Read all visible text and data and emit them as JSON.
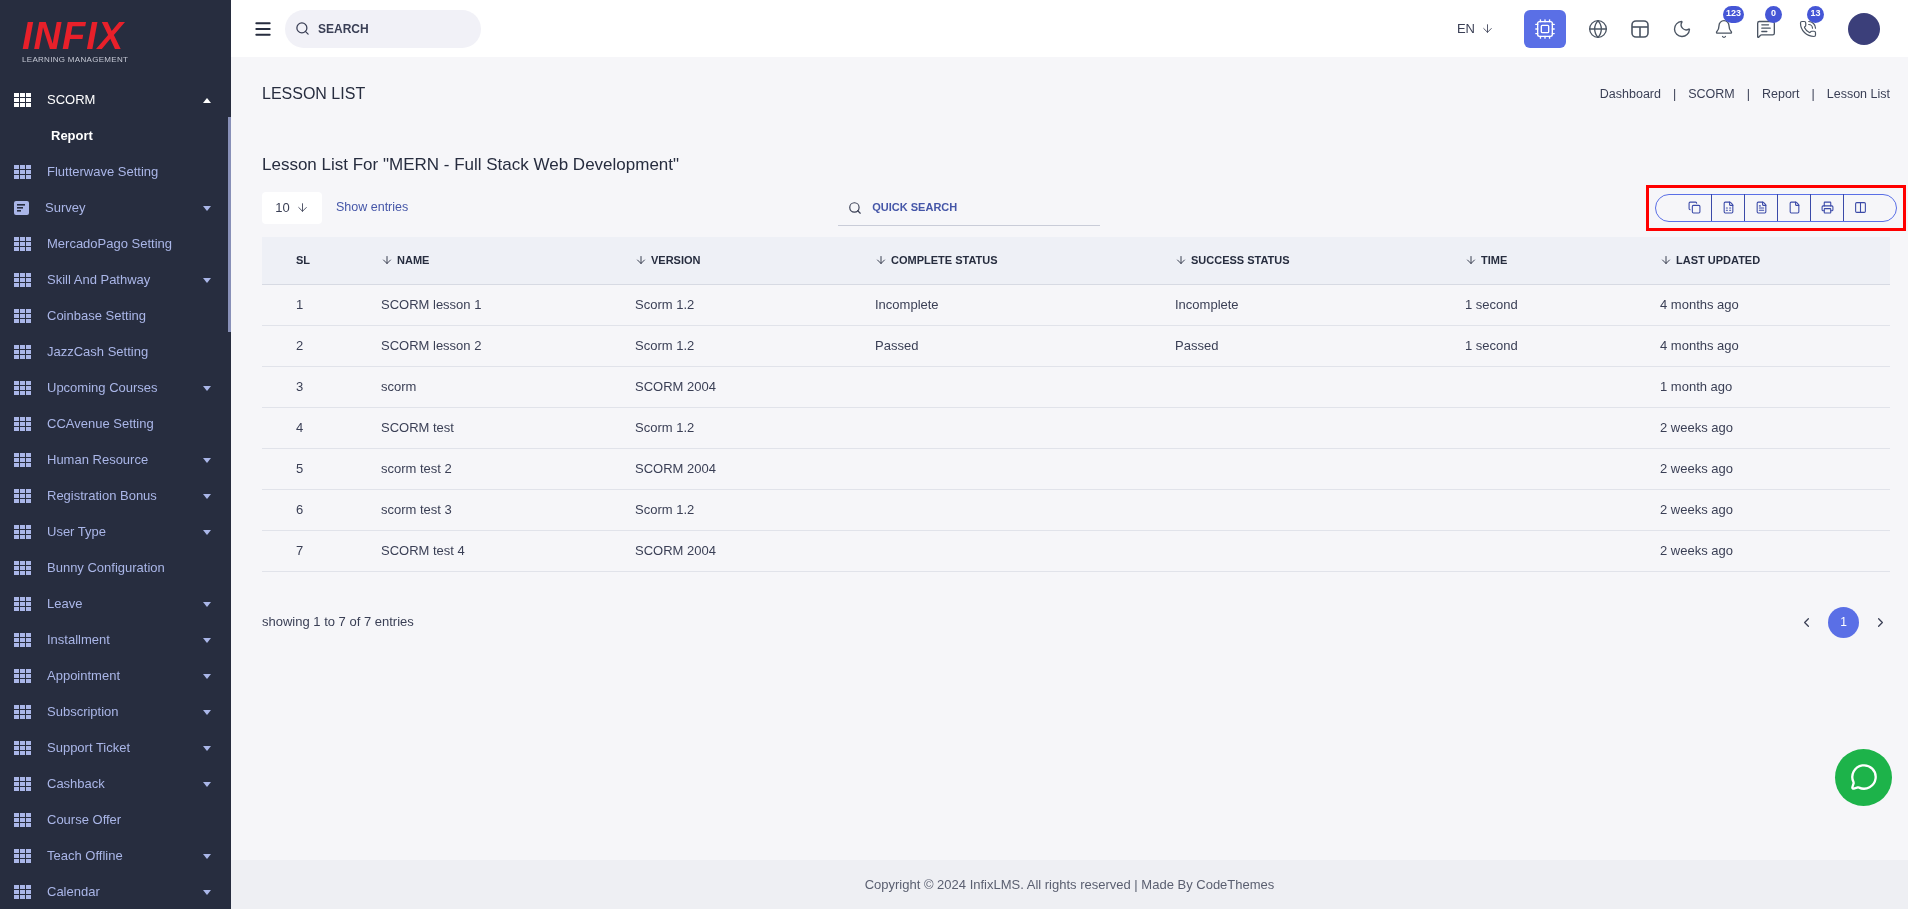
{
  "brand": {
    "logo": "INFIX",
    "tagline": "LEARNING MANAGEMENT"
  },
  "sidebar": {
    "items": [
      {
        "label": "SCORM",
        "kind": "grid",
        "expanded": true,
        "children": [
          {
            "label": "Report",
            "selected": true
          }
        ]
      },
      {
        "label": "Flutterwave Setting",
        "kind": "grid"
      },
      {
        "label": "Survey",
        "kind": "list",
        "expanded": false
      },
      {
        "label": "MercadoPago Setting",
        "kind": "grid"
      },
      {
        "label": "Skill And Pathway",
        "kind": "grid",
        "expanded": false
      },
      {
        "label": "Coinbase Setting",
        "kind": "grid"
      },
      {
        "label": "JazzCash Setting",
        "kind": "grid"
      },
      {
        "label": "Upcoming Courses",
        "kind": "grid",
        "expanded": false
      },
      {
        "label": "CCAvenue Setting",
        "kind": "grid"
      },
      {
        "label": "Human Resource",
        "kind": "grid",
        "expanded": false
      },
      {
        "label": "Registration Bonus",
        "kind": "grid",
        "expanded": false
      },
      {
        "label": "User Type",
        "kind": "grid",
        "expanded": false
      },
      {
        "label": "Bunny Configuration",
        "kind": "grid"
      },
      {
        "label": "Leave",
        "kind": "grid",
        "expanded": false
      },
      {
        "label": "Installment",
        "kind": "grid",
        "expanded": false
      },
      {
        "label": "Appointment",
        "kind": "grid",
        "expanded": false
      },
      {
        "label": "Subscription",
        "kind": "grid",
        "expanded": false
      },
      {
        "label": "Support Ticket",
        "kind": "grid",
        "expanded": false
      },
      {
        "label": "Cashback",
        "kind": "grid",
        "expanded": false
      },
      {
        "label": "Course Offer",
        "kind": "grid"
      },
      {
        "label": "Teach Offline",
        "kind": "grid",
        "expanded": false
      },
      {
        "label": "Calendar",
        "kind": "grid",
        "expanded": false
      }
    ]
  },
  "topbar": {
    "search_placeholder": "SEARCH",
    "language": "EN",
    "icons": [
      {
        "kind": "ai"
      },
      {
        "kind": "globe"
      },
      {
        "kind": "layout"
      },
      {
        "kind": "moon"
      },
      {
        "kind": "bell",
        "badge": "123"
      },
      {
        "kind": "chat",
        "badge": "0"
      },
      {
        "kind": "whatsapp",
        "badge": "13"
      }
    ]
  },
  "page": {
    "title": "LESSON LIST",
    "breadcrumbs": [
      "Dashboard",
      "SCORM",
      "Report",
      "Lesson List"
    ],
    "breadcrumb_separator": "|"
  },
  "card": {
    "heading": "Lesson List For \"MERN - Full Stack Web Development\"",
    "page_size": "10",
    "show_entries": "Show entries",
    "quick_search_placeholder": "QUICK SEARCH",
    "highlighted": true,
    "export_buttons": [
      {
        "kind": "copy"
      },
      {
        "kind": "excel"
      },
      {
        "kind": "csv"
      },
      {
        "kind": "pdf"
      },
      {
        "kind": "print"
      },
      {
        "kind": "columns"
      }
    ]
  },
  "table": {
    "columns": [
      {
        "label": "SL",
        "sortable": false
      },
      {
        "label": "NAME",
        "sortable": true
      },
      {
        "label": "VERSION",
        "sortable": true
      },
      {
        "label": "COMPLETE STATUS",
        "sortable": true
      },
      {
        "label": "SUCCESS STATUS",
        "sortable": true
      },
      {
        "label": "TIME",
        "sortable": true
      },
      {
        "label": "LAST UPDATED",
        "sortable": true
      }
    ],
    "rows": [
      [
        "1",
        "SCORM lesson 1",
        "Scorm 1.2",
        "Incomplete",
        "Incomplete",
        "1 second",
        "4 months ago"
      ],
      [
        "2",
        "SCORM lesson 2",
        "Scorm 1.2",
        "Passed",
        "Passed",
        "1 second",
        "4 months ago"
      ],
      [
        "3",
        "scorm",
        "SCORM 2004",
        "",
        "",
        "",
        "1 month ago"
      ],
      [
        "4",
        "SCORM test",
        "Scorm 1.2",
        "",
        "",
        "",
        "2 weeks ago"
      ],
      [
        "5",
        "scorm test 2",
        "SCORM 2004",
        "",
        "",
        "",
        "2 weeks ago"
      ],
      [
        "6",
        "scorm test 3",
        "Scorm 1.2",
        "",
        "",
        "",
        "2 weeks ago"
      ],
      [
        "7",
        "SCORM test 4",
        "SCORM 2004",
        "",
        "",
        "",
        "2 weeks ago"
      ]
    ]
  },
  "table_info": "showing 1 to 7 of 7 entries",
  "pagination": {
    "pages": [
      {
        "label": "1",
        "selected": true
      }
    ]
  },
  "footer": "Copyright © 2024 InfixLMS. All rights reserved | Made By CodeThemes"
}
